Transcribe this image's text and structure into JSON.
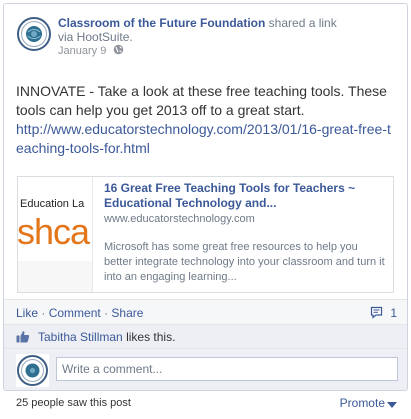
{
  "post": {
    "author": "Classroom of the Future Foundation",
    "action": "shared",
    "action_link": "a link",
    "via": "via HootSuite.",
    "date": "January 9",
    "privacy_icon": "globe-icon",
    "message": "INNOVATE - Take a look at these free teaching tools. These tools can help you get 2013 off to a great start.",
    "url": "http://www.educatorstechnology.com/2013/01/16-great-free-teaching-tools-for.html"
  },
  "attachment": {
    "thumb_line": "Education La",
    "thumb_big": "shca",
    "title": "16 Great Free Teaching Tools for Teachers ~ Educational Technology and...",
    "domain": "www.educatorstechnology.com",
    "description": "Microsoft has some great free resources to help you better integrate technology into your classroom and turn it into an engaging learning..."
  },
  "actions": {
    "like": "Like",
    "comment": "Comment",
    "share": "Share",
    "separator": "·",
    "comments_count": "1"
  },
  "likes": {
    "name": "Tabitha Stillman",
    "suffix": "likes this."
  },
  "comment_box": {
    "placeholder": "Write a comment..."
  },
  "footer": {
    "seen": "25 people saw this post",
    "promote": "Promote"
  },
  "colors": {
    "link": "#3b5998",
    "muted": "#6f7a89",
    "action_bar": "#f6f7f9",
    "likes_bar": "#edeff4",
    "thumb_accent": "#e3761b"
  }
}
